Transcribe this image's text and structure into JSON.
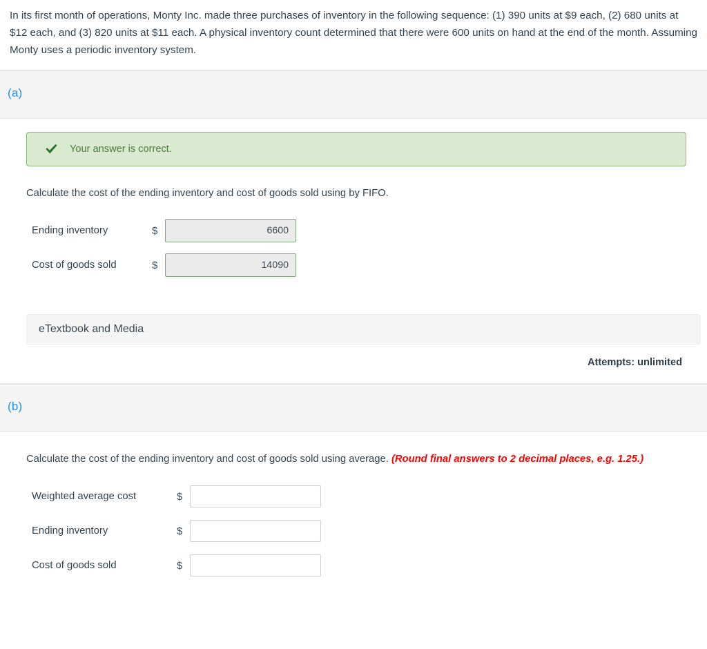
{
  "question": {
    "stem": "In its first month of operations, Monty Inc. made three purchases of inventory in the following sequence: (1) 390 units at $9 each, (2) 680 units at $12 each, and (3) 820 units at $11 each. A physical inventory count determined that there were 600 units on hand at the end of the month. Assuming Monty uses a periodic inventory system."
  },
  "colors": {
    "part_label": "#1e90f5",
    "alert_bg": "#d9ead0",
    "alert_border": "#8cb97c",
    "alert_check": "#2f7030",
    "note_red": "#ff0000",
    "locked_input_border": "#7fab7c",
    "locked_input_bg": "#ebebeb"
  },
  "parts": [
    {
      "id": "a",
      "label": "(a)",
      "alert": {
        "icon": "check-icon",
        "text": "Your answer is correct."
      },
      "prompt": "Calculate the cost of the ending inventory and cost of goods sold using by FIFO.",
      "prompt_note": "",
      "currency_symbol": "$",
      "rows": [
        {
          "label": "Ending inventory",
          "value": "6600",
          "placeholder": ""
        },
        {
          "label": "Cost of goods sold",
          "value": "14090",
          "placeholder": ""
        }
      ],
      "etextbook_label": "eTextbook and Media",
      "attempts": "Attempts: unlimited"
    },
    {
      "id": "b",
      "label": "(b)",
      "prompt": "Calculate the cost of the ending inventory and cost of goods sold using average.",
      "prompt_note": "(Round final answers to 2 decimal places, e.g. 1.25.)",
      "currency_symbol": "$",
      "rows": [
        {
          "label": "Weighted average cost",
          "value": "",
          "placeholder": ""
        },
        {
          "label": "Ending inventory",
          "value": "",
          "placeholder": ""
        },
        {
          "label": "Cost of goods sold",
          "value": "",
          "placeholder": ""
        }
      ]
    }
  ]
}
